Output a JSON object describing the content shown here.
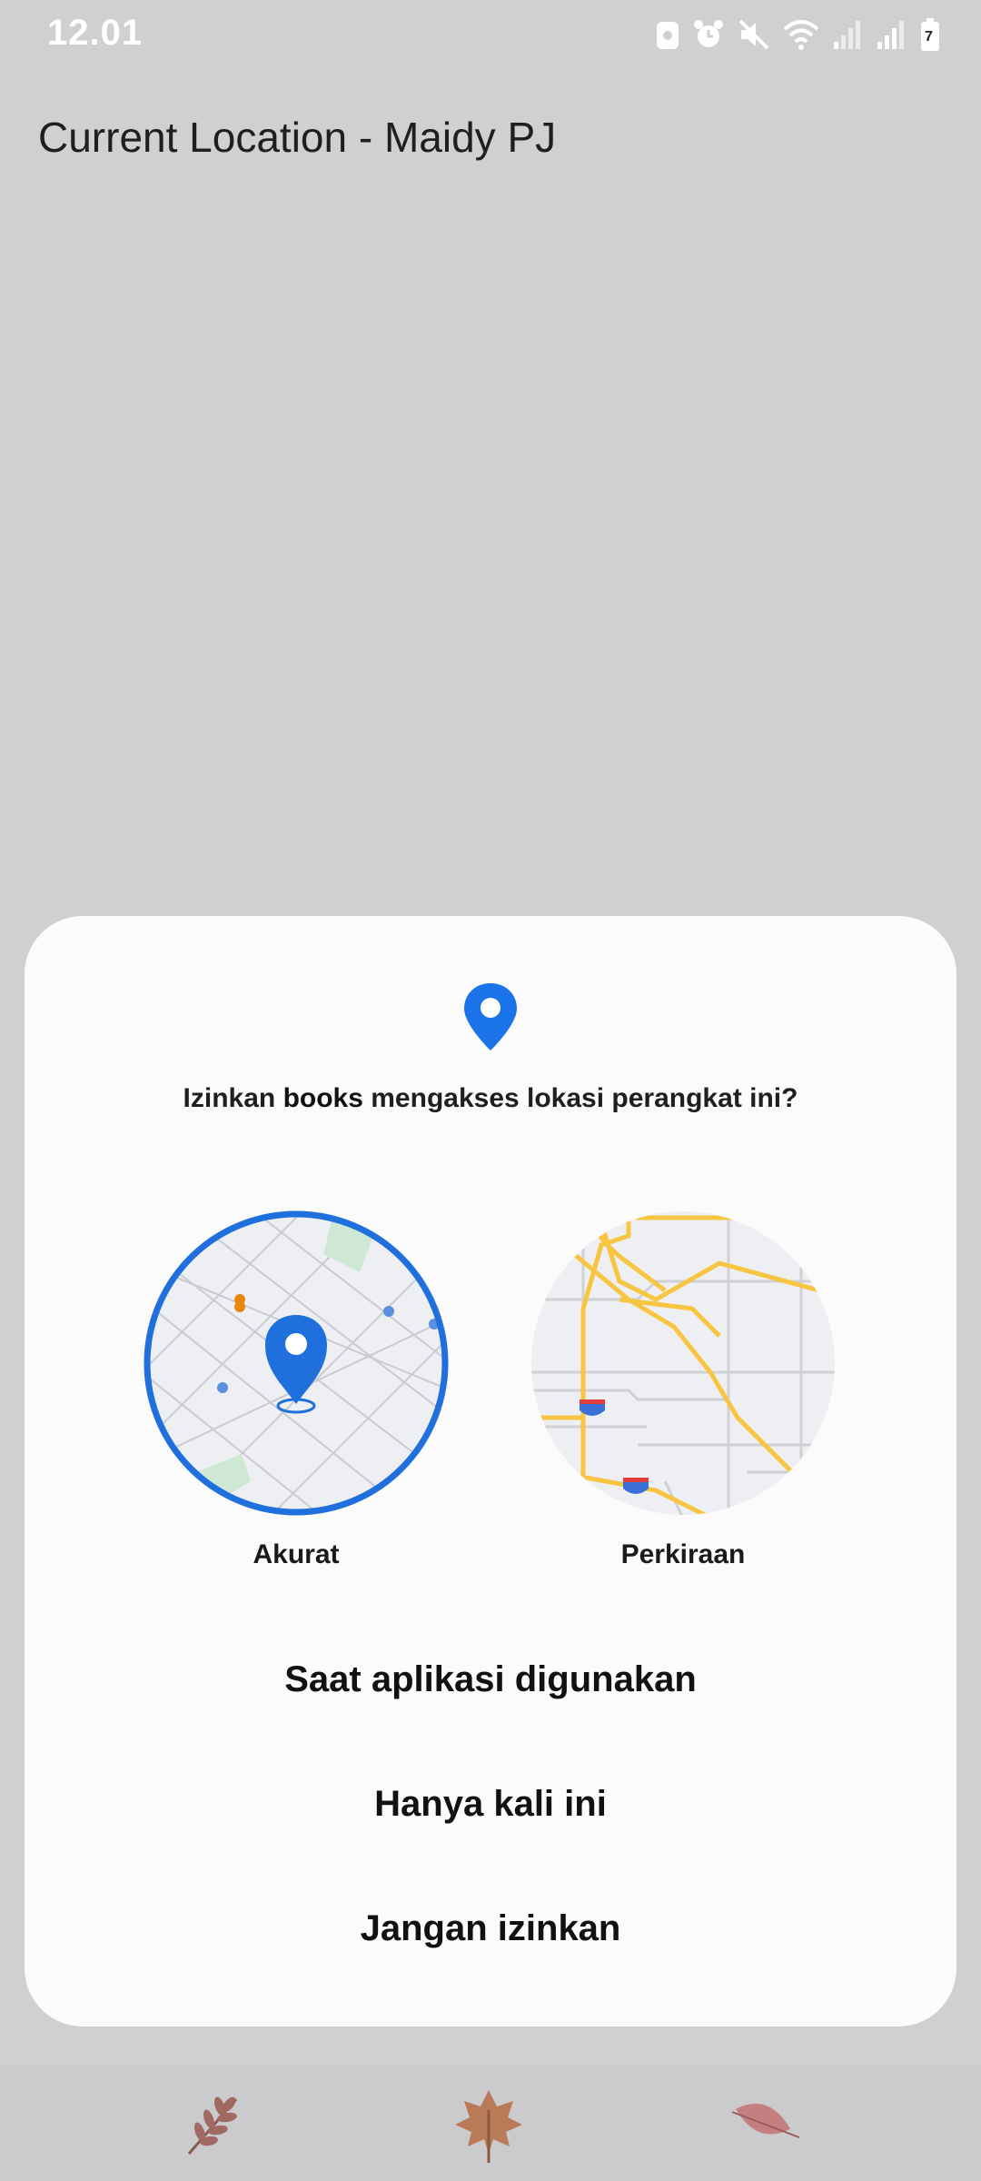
{
  "status_bar": {
    "time": "12.01",
    "icons": [
      "screenshot-icon",
      "alarm-icon",
      "mute-icon",
      "wifi-icon",
      "signal-icon",
      "signal-icon",
      "battery-icon"
    ],
    "battery_level": "7"
  },
  "app": {
    "title": "Current Location - Maidy PJ"
  },
  "dialog": {
    "prompt_before": "Izinkan ",
    "app_name": "books",
    "prompt_after": " mengakses lokasi perangkat ini?",
    "options": {
      "precise_label": "Akurat",
      "approximate_label": "Perkiraan",
      "selected": "Akurat"
    },
    "buttons": {
      "while_using": "Saat aplikasi digunakan",
      "only_this_time": "Hanya kali ini",
      "deny": "Jangan izinkan"
    },
    "colors": {
      "accent": "#1f6fdc",
      "road": "#f7c541",
      "map_bg": "#eeeff3"
    }
  },
  "nav_bar": {
    "buttons": [
      "recent-apps-leaf-icon",
      "home-leaf-icon",
      "back-leaf-icon"
    ]
  }
}
